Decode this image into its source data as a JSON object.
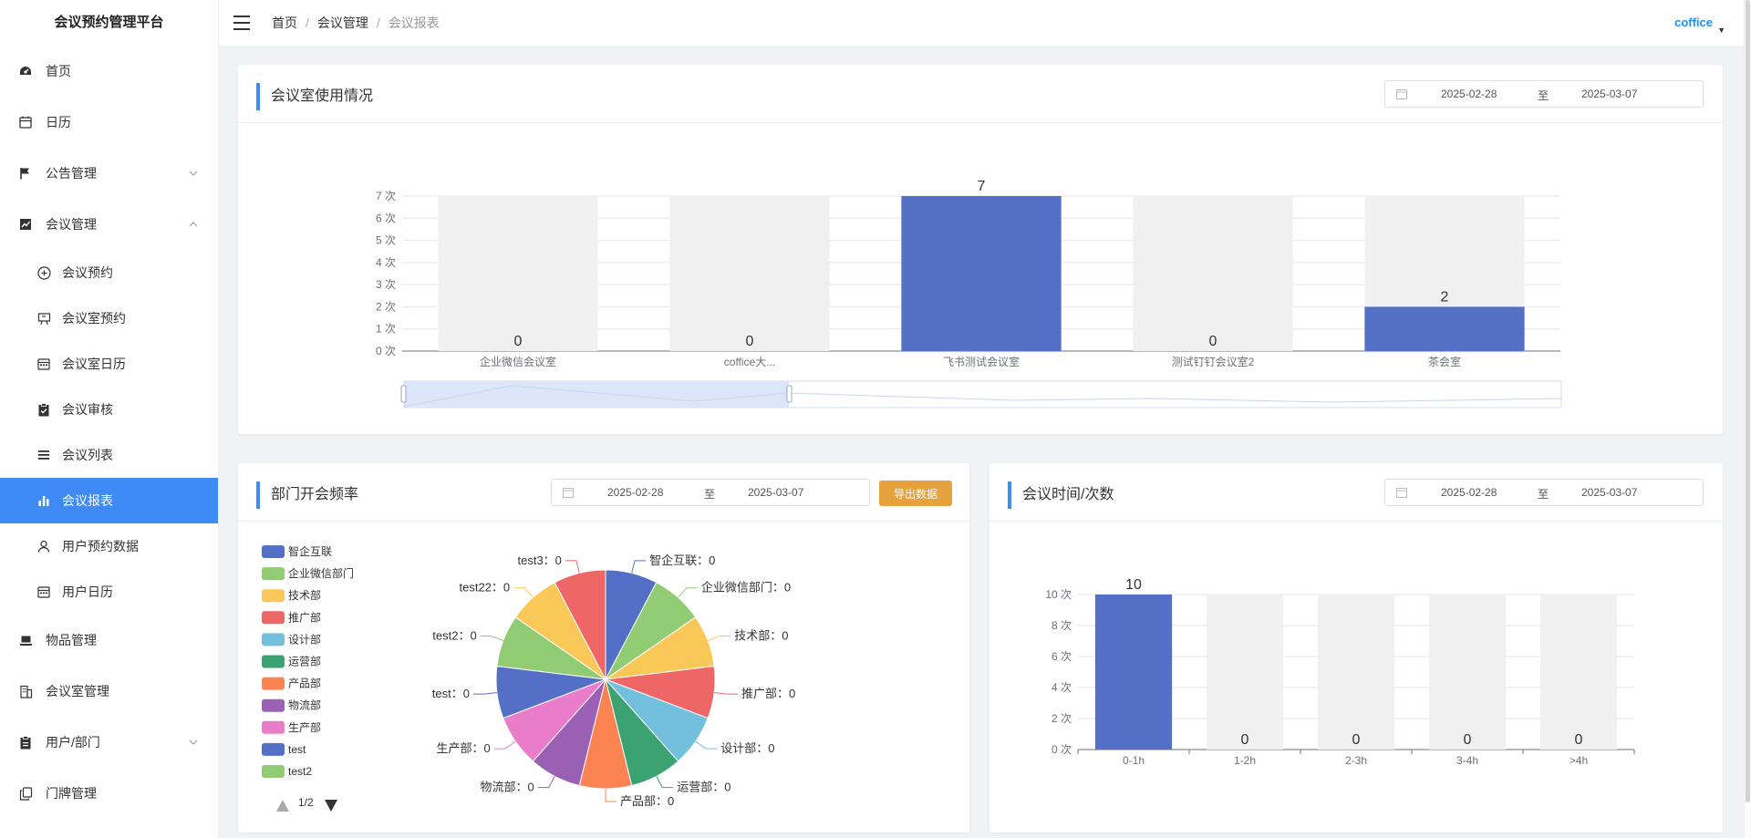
{
  "app": {
    "title": "会议预约管理平台"
  },
  "sidebar": {
    "items": [
      {
        "label": "首页",
        "icon": "dashboard-icon"
      },
      {
        "label": "日历",
        "icon": "calendar-icon"
      },
      {
        "label": "公告管理",
        "icon": "flag-icon",
        "arrow": "down"
      },
      {
        "label": "会议管理",
        "icon": "chart-line-icon",
        "arrow": "up"
      }
    ],
    "sub_items": [
      {
        "label": "会议预约",
        "icon": "plus-circle-icon"
      },
      {
        "label": "会议室预约",
        "icon": "presentation-icon"
      },
      {
        "label": "会议室日历",
        "icon": "calendar-icon"
      },
      {
        "label": "会议审核",
        "icon": "clipboard-check-icon"
      },
      {
        "label": "会议列表",
        "icon": "list-icon"
      },
      {
        "label": "会议报表",
        "icon": "bar-chart-icon",
        "active": true
      },
      {
        "label": "用户预约数据",
        "icon": "user-icon"
      },
      {
        "label": "用户日历",
        "icon": "calendar-icon"
      }
    ],
    "bottom_items": [
      {
        "label": "物品管理",
        "icon": "laptop-icon"
      },
      {
        "label": "会议室管理",
        "icon": "building-icon"
      },
      {
        "label": "用户/部门",
        "icon": "clipboard-icon",
        "arrow": "down"
      },
      {
        "label": "门牌管理",
        "icon": "copy-icon"
      }
    ]
  },
  "header": {
    "breadcrumb": [
      "首页",
      "会议管理",
      "会议报表"
    ],
    "user": "coffice"
  },
  "room_usage": {
    "title": "会议室使用情况",
    "date_from": "2025-02-28",
    "date_sep": "至",
    "date_to": "2025-03-07"
  },
  "dept_freq": {
    "title": "部门开会频率",
    "date_from": "2025-02-28",
    "date_sep": "至",
    "date_to": "2025-03-07",
    "export_label": "导出数据",
    "pager": "1/2"
  },
  "meeting_time": {
    "title": "会议时间/次数",
    "date_from": "2025-02-28",
    "date_sep": "至",
    "date_to": "2025-03-07"
  },
  "chart_data": [
    {
      "type": "bar",
      "categories": [
        "企业微信会议室",
        "coffice大...",
        "飞书测试会议室",
        "测试钉钉会议室2",
        "茶会室"
      ],
      "values": [
        0,
        0,
        7,
        0,
        2
      ],
      "ylim": [
        0,
        7
      ],
      "yticks": [
        "0 次",
        "1 次",
        "2 次",
        "3 次",
        "4 次",
        "5 次",
        "6 次",
        "7 次"
      ],
      "grid": true,
      "color": "#5470c6",
      "background_color": "#f0f0f0"
    },
    {
      "type": "pie",
      "labels": [
        "智企互联",
        "企业微信部门",
        "技术部",
        "推广部",
        "设计部",
        "运营部",
        "产品部",
        "物流部",
        "生产部",
        "test",
        "test2",
        "test22",
        "test3"
      ],
      "values": [
        0,
        0,
        0,
        0,
        0,
        0,
        0,
        0,
        0,
        0,
        0,
        0,
        0
      ],
      "colors": [
        "#5470c6",
        "#91cc75",
        "#fac858",
        "#ee6666",
        "#73c0de",
        "#3ba272",
        "#fc8452",
        "#9a60b4",
        "#ea7ccc",
        "#5470c6",
        "#91cc75",
        "#fac858",
        "#ee6666"
      ],
      "legend_visible": [
        "智企互联",
        "企业微信部门",
        "技术部",
        "推广部",
        "设计部",
        "运营部",
        "产品部",
        "物流部",
        "生产部",
        "test",
        "test2"
      ],
      "legend_position": "left",
      "label_separator": "："
    },
    {
      "type": "bar",
      "categories": [
        "0-1h",
        "1-2h",
        "2-3h",
        "3-4h",
        ">4h"
      ],
      "values": [
        10,
        0,
        0,
        0,
        0
      ],
      "ylim": [
        0,
        10
      ],
      "yticks": [
        "0 次",
        "2 次",
        "4 次",
        "6 次",
        "8 次",
        "10 次"
      ],
      "grid": true,
      "color": "#5470c6",
      "background_color": "#f0f0f0"
    }
  ]
}
